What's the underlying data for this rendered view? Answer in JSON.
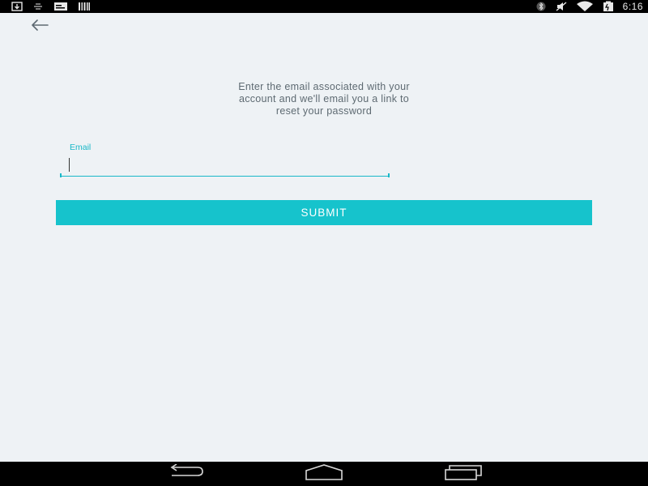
{
  "status_bar": {
    "time": "6:16",
    "left_icons": [
      "download-icon",
      "voicemail-icon",
      "message-icon",
      "barcode-icon"
    ],
    "right_icons": [
      "bluetooth-icon",
      "mute-icon",
      "wifi-icon",
      "battery-icon"
    ]
  },
  "header": {
    "back_icon": "arrow-left-icon"
  },
  "instructions": {
    "line1": "Enter the email associated with your",
    "line2": "account and we'll email you a link to",
    "line3": "reset your password"
  },
  "email": {
    "label": "Email",
    "value": ""
  },
  "submit": {
    "label": "SUBMIT"
  },
  "nav_bar": {
    "icons": [
      "nav-back-icon",
      "nav-home-icon",
      "nav-recent-apps-icon"
    ]
  },
  "colors": {
    "accent": "#16c3cc",
    "background": "#eef2f5",
    "text": "#5e6a72"
  }
}
